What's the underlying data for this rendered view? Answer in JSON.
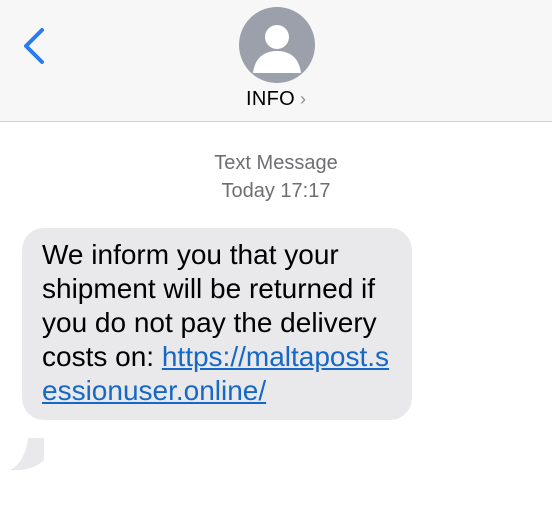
{
  "header": {
    "back_icon": "chevron-left-icon",
    "avatar_icon": "person-silhouette-icon",
    "contact_name": "INFO",
    "contact_chevron": "›",
    "accent_color": "#2b7cf0"
  },
  "conversation": {
    "service_label": "Text Message",
    "timestamp": "Today 17:17",
    "message": {
      "text": "We inform you that your shipment will be returned if you do not pay the delivery costs on: ",
      "link_text": "https://maltapost.sessionuser.online/",
      "bubble_color": "#e9e9eb",
      "link_color": "#1668c7"
    }
  }
}
